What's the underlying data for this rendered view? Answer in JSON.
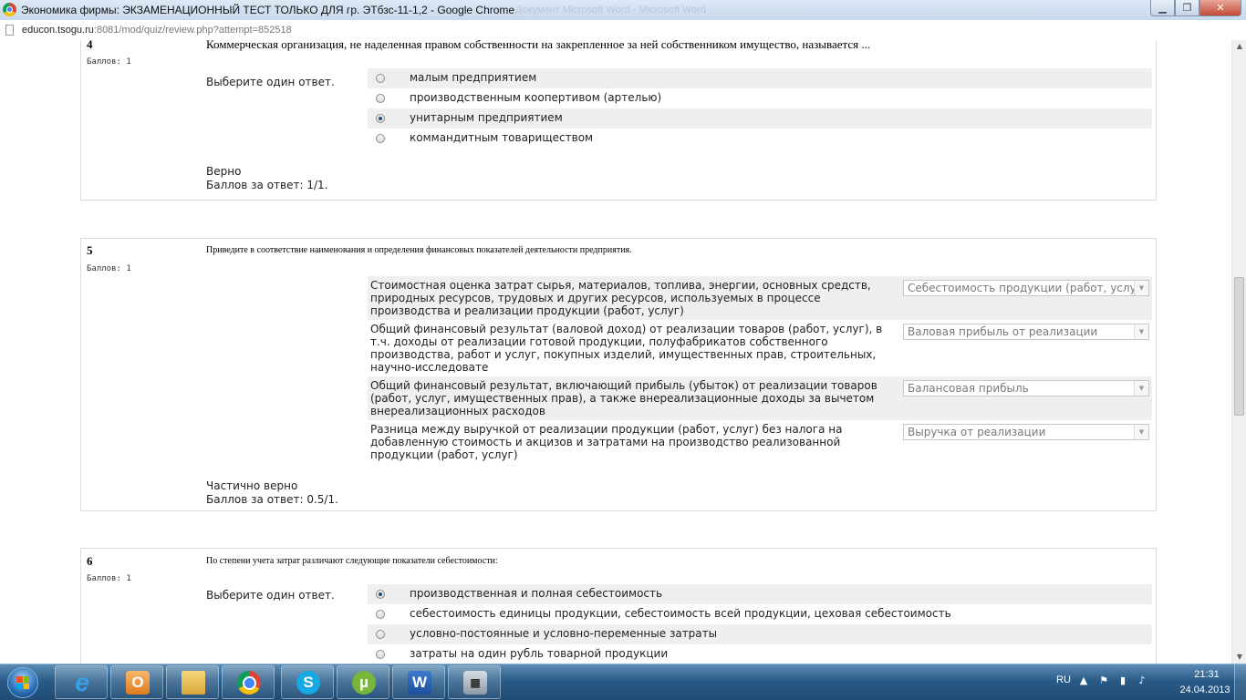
{
  "window": {
    "title": "Экономика фирмы: ЭКЗАМЕНАЦИОННЫЙ ТЕСТ ТОЛЬКО ДЛЯ гр. ЭТбзс-11-1,2 - Google Chrome",
    "background_title": "Документ Microsoft Word - Microsoft Word",
    "buttons": {
      "minimize": "▁",
      "maximize": "❐",
      "close": "✕"
    }
  },
  "address": {
    "host": "educon.tsogu.ru",
    "rest": ":8081/mod/quiz/review.php?attempt=852518"
  },
  "questions": [
    {
      "number": "4",
      "grade": "Баллов: 1",
      "text": "Коммерческая организация, не наделенная правом собственности на закрепленное за ней собственником имущество, называется ...",
      "prompt": "Выберите один ответ.",
      "answers": [
        {
          "label": "малым предприятием",
          "checked": false
        },
        {
          "label": "производственным коопертивом (артелью)",
          "checked": false
        },
        {
          "label": "унитарным предприятием",
          "checked": true
        },
        {
          "label": "коммандитным товариществом",
          "checked": false
        }
      ],
      "outcome": "Верно",
      "score": "Баллов за ответ: 1/1."
    },
    {
      "number": "5",
      "grade": "Баллов: 1",
      "text": "Приведите в соответствие наименования и определения финансовых показателей деятельности предприятия.",
      "matches": [
        {
          "text": "Стоимостная оценка затрат сырья, материалов, топлива, энергии, основных средств, природных ресурсов, трудовых и других ресурсов, используемых в процессе производства и реализации продукции (работ, услуг)",
          "selected": "Себестоимость продукции (работ, услуг)"
        },
        {
          "text": "Общий финансовый результат (валовой доход) от реализации товаров (работ, услуг), в т.ч. доходы от реализации готовой продукции, полуфабрикатов собственного производства, работ и услуг, покупных изделий, имущественных прав, строительных, научно-исследовате",
          "selected": "Валовая прибыль от реализации"
        },
        {
          "text": "Общий финансовый результат, включающий прибыль (убыток) от реализации товаров (работ, услуг, имущественных прав), а также внереализационные доходы за вычетом внереализационных расходов",
          "selected": "Балансовая прибыль"
        },
        {
          "text": "Разница между выручкой от реализации продукции (работ, услуг) без налога на добавленную стоимость и акцизов и затратами на производство реализованной продукции (работ, услуг)",
          "selected": "Выручка от реализации"
        }
      ],
      "outcome": "Частично верно",
      "score": "Баллов за ответ: 0.5/1."
    },
    {
      "number": "6",
      "grade": "Баллов: 1",
      "text": "По степени учета затрат различают следующие показатели себестоимости:",
      "prompt": "Выберите один ответ.",
      "answers": [
        {
          "label": "производственная и полная себестоимость",
          "checked": true
        },
        {
          "label": "себестоимость единицы продукции, себестоимость всей продукции, цеховая себестоимость",
          "checked": false
        },
        {
          "label": "условно-постоянные и условно-переменные затраты",
          "checked": false
        },
        {
          "label": "затраты на один рубль товарной продукции",
          "checked": false
        }
      ]
    }
  ],
  "taskbar": {
    "apps": [
      {
        "name": "internet-explorer",
        "glyph": "e"
      },
      {
        "name": "outlook",
        "glyph": "O"
      },
      {
        "name": "windows-explorer",
        "glyph": ""
      },
      {
        "name": "google-chrome",
        "glyph": ""
      },
      {
        "name": "skype",
        "glyph": "S"
      },
      {
        "name": "utorrent",
        "glyph": "µ"
      },
      {
        "name": "microsoft-word",
        "glyph": "W"
      },
      {
        "name": "calculator",
        "glyph": "▦"
      }
    ],
    "tray": {
      "lang": "RU",
      "time": "21:31",
      "date": "24.04.2013"
    }
  }
}
